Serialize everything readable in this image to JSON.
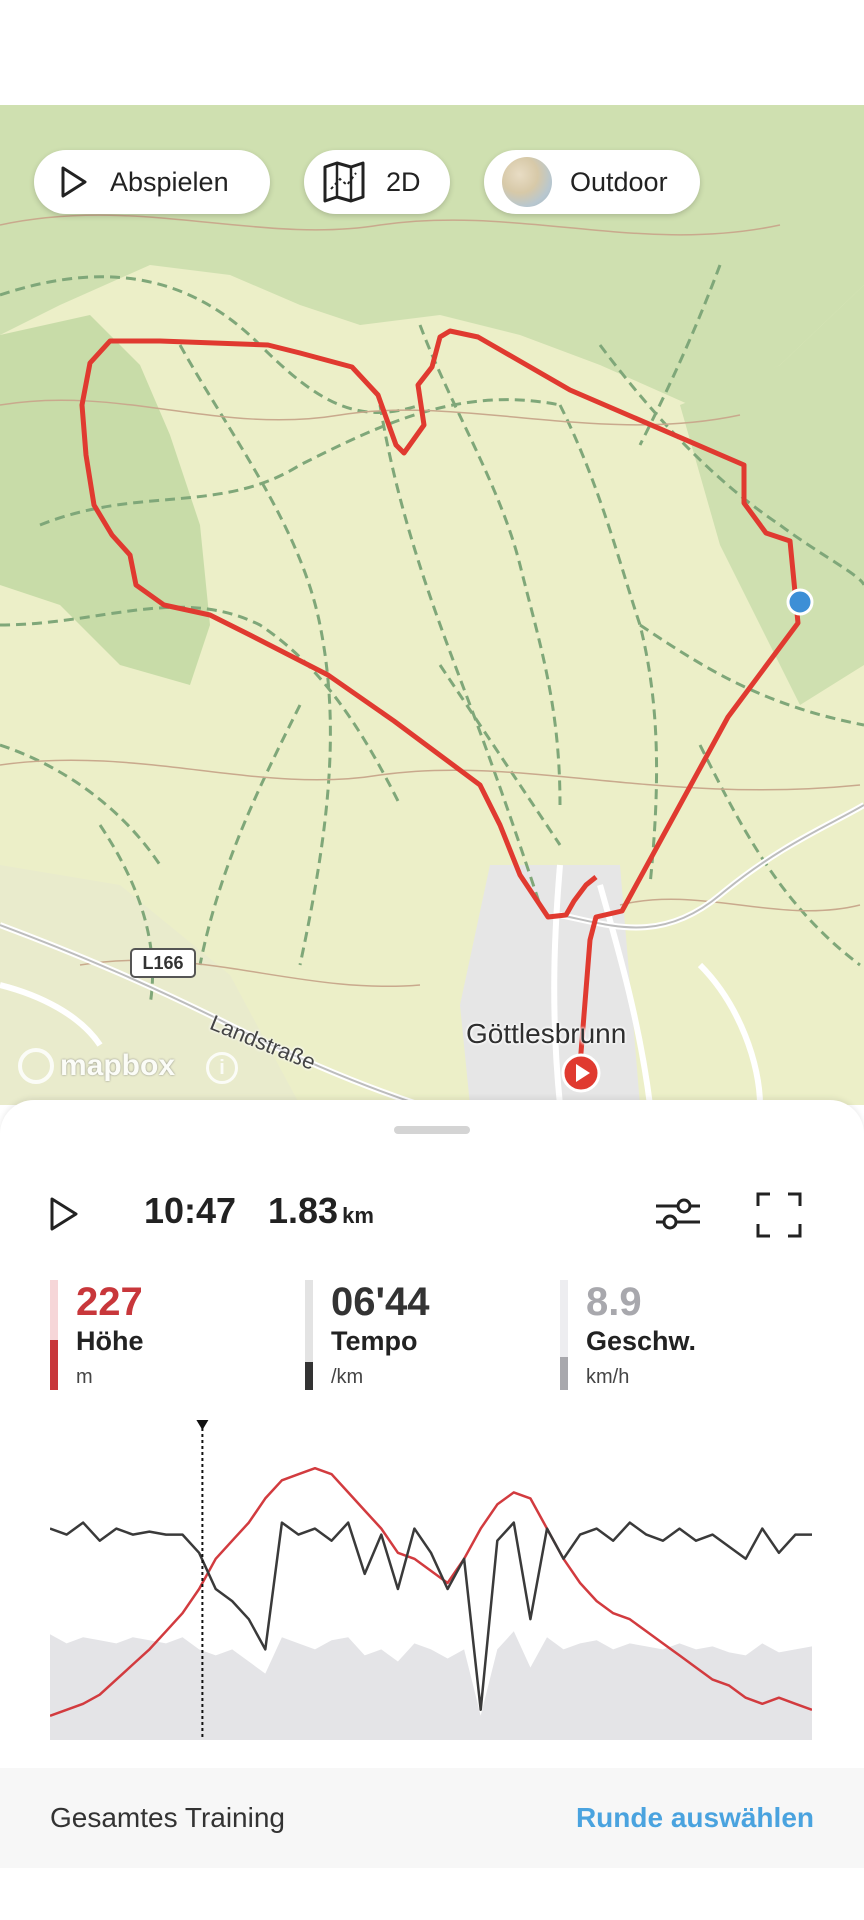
{
  "map": {
    "buttons": {
      "play_label": "Abspielen",
      "view_label": "2D",
      "style_label": "Outdoor"
    },
    "place_label": "Göttlesbrunn",
    "road_label": "Landstraße",
    "road_shield": "L166",
    "attribution": "mapbox",
    "info_glyph": "i",
    "route_color": "#e03a30",
    "marker_color": "#3d8fd6"
  },
  "player": {
    "time": "10:47",
    "distance": "1.83",
    "distance_unit": "km"
  },
  "stats": [
    {
      "value": "227",
      "label": "Höhe",
      "unit": "m",
      "color": "#c8373b",
      "fill_fraction": 0.45
    },
    {
      "value": "06'44",
      "label": "Tempo",
      "unit": "/km",
      "color": "#333333",
      "fill_fraction": 0.25
    },
    {
      "value": "8.9",
      "label": "Geschw.",
      "unit": "km/h",
      "color": "#a8a8ad",
      "fill_fraction": 0.3
    }
  ],
  "chart_data": {
    "type": "line",
    "cursor_fraction": 0.2,
    "series": [
      {
        "values": [
          0.08,
          0.1,
          0.12,
          0.15,
          0.2,
          0.25,
          0.3,
          0.36,
          0.42,
          0.5,
          0.6,
          0.66,
          0.72,
          0.8,
          0.86,
          0.88,
          0.9,
          0.88,
          0.82,
          0.76,
          0.7,
          0.62,
          0.6,
          0.56,
          0.52,
          0.6,
          0.7,
          0.78,
          0.82,
          0.8,
          0.7,
          0.6,
          0.52,
          0.46,
          0.42,
          0.4,
          0.36,
          0.32,
          0.28,
          0.24,
          0.2,
          0.18,
          0.14,
          0.12,
          0.14,
          0.12,
          0.1
        ],
        "color": "#d23b3f"
      },
      {
        "values": [
          0.7,
          0.68,
          0.72,
          0.66,
          0.7,
          0.68,
          0.69,
          0.68,
          0.68,
          0.62,
          0.5,
          0.46,
          0.4,
          0.3,
          0.72,
          0.68,
          0.7,
          0.66,
          0.72,
          0.55,
          0.68,
          0.5,
          0.7,
          0.62,
          0.5,
          0.6,
          0.1,
          0.66,
          0.72,
          0.4,
          0.7,
          0.6,
          0.68,
          0.7,
          0.66,
          0.72,
          0.68,
          0.66,
          0.7,
          0.66,
          0.68,
          0.64,
          0.6,
          0.7,
          0.62,
          0.68,
          0.68
        ],
        "color": "#3a3a3a"
      },
      {
        "values": [
          0.35,
          0.32,
          0.34,
          0.33,
          0.32,
          0.34,
          0.33,
          0.32,
          0.34,
          0.3,
          0.28,
          0.3,
          0.26,
          0.22,
          0.34,
          0.32,
          0.3,
          0.33,
          0.34,
          0.28,
          0.3,
          0.26,
          0.32,
          0.3,
          0.27,
          0.3,
          0.08,
          0.3,
          0.36,
          0.24,
          0.34,
          0.3,
          0.32,
          0.33,
          0.3,
          0.32,
          0.31,
          0.3,
          0.32,
          0.3,
          0.31,
          0.29,
          0.28,
          0.32,
          0.29,
          0.3,
          0.31
        ],
        "color": "#e4e4e7"
      }
    ]
  },
  "footer": {
    "left_label": "Gesamtes Training",
    "right_label": "Runde auswählen"
  }
}
